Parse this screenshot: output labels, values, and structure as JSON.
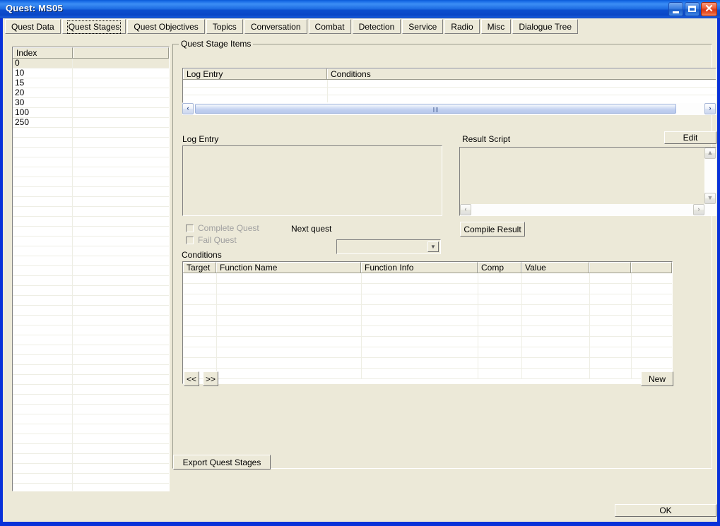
{
  "window": {
    "title": "Quest: MS05",
    "controls": {
      "minimize": "minimize-button",
      "maximize": "maximize-button",
      "close_glyph": "✕"
    }
  },
  "tabs": [
    {
      "label": "Quest Data",
      "selected": false
    },
    {
      "label": "Quest Stages",
      "selected": true
    },
    {
      "label": "Quest Objectives",
      "selected": false
    },
    {
      "label": "Topics",
      "selected": false
    },
    {
      "label": "Conversation",
      "selected": false
    },
    {
      "label": "Combat",
      "selected": false
    },
    {
      "label": "Detection",
      "selected": false
    },
    {
      "label": "Service",
      "selected": false
    },
    {
      "label": "Radio",
      "selected": false
    },
    {
      "label": "Misc",
      "selected": false
    },
    {
      "label": "Dialogue Tree",
      "selected": false
    }
  ],
  "index_list": {
    "columns": [
      "Index",
      ""
    ],
    "rows": [
      "0",
      "10",
      "15",
      "20",
      "30",
      "100",
      "250"
    ],
    "selected_index": 0,
    "total_visible_rows": 44
  },
  "quest_stage_items": {
    "group_label": "Quest Stage Items",
    "columns": [
      "Log Entry",
      "Conditions"
    ],
    "rows": [],
    "empty_row_count": 3,
    "hscroll": {
      "left_arrow": "‹",
      "right_arrow": "›",
      "thumb_position": "full"
    }
  },
  "log_entry": {
    "label": "Log Entry",
    "value": "",
    "placeholder": ""
  },
  "result_script": {
    "label": "Result Script",
    "edit_button": "Edit",
    "value": "",
    "compile_button": "Compile Result",
    "vscroll": {
      "up": "▲",
      "down": "▼"
    },
    "hscroll": {
      "left": "‹",
      "right": "›"
    }
  },
  "flags": {
    "complete_quest": {
      "label": "Complete Quest",
      "checked": false,
      "enabled": false
    },
    "fail_quest": {
      "label": "Fail Quest",
      "checked": false,
      "enabled": false
    }
  },
  "next_quest": {
    "label": "Next quest",
    "value": "",
    "arrow": "▼",
    "options": []
  },
  "conditions": {
    "label": "Conditions",
    "columns": [
      "Target",
      "Function Name",
      "Function Info",
      "Comp",
      "Value",
      "",
      ""
    ],
    "rows": [],
    "empty_row_count": 10,
    "prev_button": "<<",
    "next_button": ">>",
    "new_button": "New"
  },
  "footer": {
    "export_button": "Export Quest Stages",
    "ok_button": "OK"
  },
  "colors": {
    "window_border": "#0831d9",
    "titlebar_start": "#3c8ef5",
    "titlebar_end": "#0831a8",
    "client_bg": "#ece9d8",
    "close_button": "#d8391a",
    "grid_bg": "#ffffff",
    "selection": "#ece9d8",
    "scroll_thumb": "#c2d1f0",
    "disabled_text": "#a0a0a0"
  }
}
